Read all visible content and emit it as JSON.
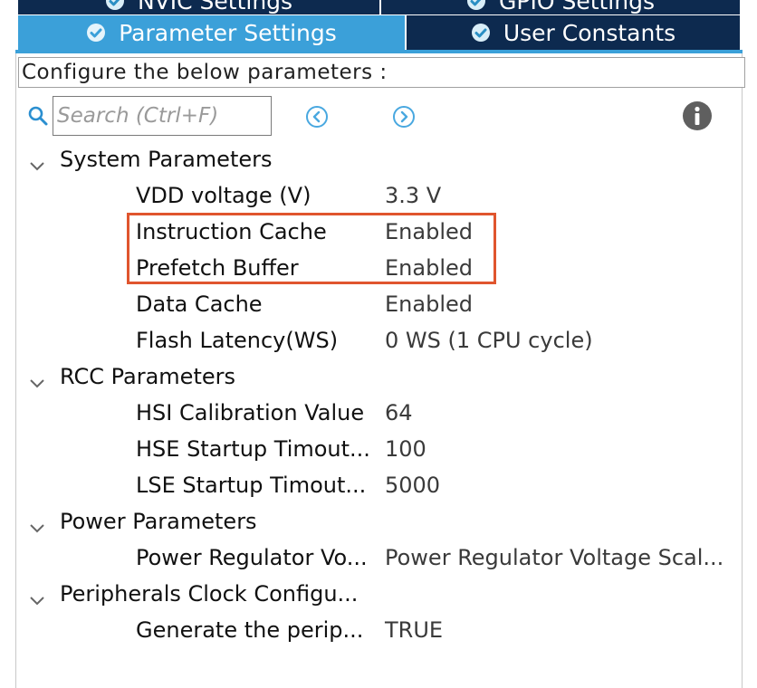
{
  "tabs": {
    "nvic_label": "NVIC Settings",
    "gpio_label": "GPIO Settings",
    "param_label": "Parameter Settings",
    "user_label": "User Constants",
    "active": "Parameter Settings",
    "check_icon": "check-circle-icon"
  },
  "configure_text": "Configure the below parameters :",
  "search": {
    "placeholder": "Search (Ctrl+F)",
    "search_icon": "search-icon",
    "prev_icon": "circle-arrow-left-icon",
    "next_icon": "circle-arrow-right-icon",
    "info_icon": "info-icon"
  },
  "groups": [
    {
      "label": "System Parameters",
      "params": [
        {
          "name": "VDD voltage (V)",
          "value": "3.3 V"
        },
        {
          "name": "Instruction Cache",
          "value": "Enabled"
        },
        {
          "name": "Prefetch Buffer",
          "value": "Enabled"
        },
        {
          "name": "Data Cache",
          "value": "Enabled"
        },
        {
          "name": "Flash Latency(WS)",
          "value": "0 WS (1 CPU cycle)"
        }
      ]
    },
    {
      "label": "RCC Parameters",
      "params": [
        {
          "name": "HSI Calibration Value",
          "value": "64"
        },
        {
          "name": "HSE Startup Timout...",
          "value": "100"
        },
        {
          "name": "LSE Startup Timout...",
          "value": "5000"
        }
      ]
    },
    {
      "label": "Power Parameters",
      "params": [
        {
          "name": "Power Regulator Vo...",
          "value": "Power Regulator Voltage Scal..."
        }
      ]
    },
    {
      "label": "Peripherals Clock Configu...",
      "params": [
        {
          "name": "Generate the perip...",
          "value": "TRUE"
        }
      ]
    }
  ],
  "colors": {
    "tab_dark": "#0d2a4f",
    "tab_active": "#3ba0d9",
    "highlight": "#e0552e"
  }
}
